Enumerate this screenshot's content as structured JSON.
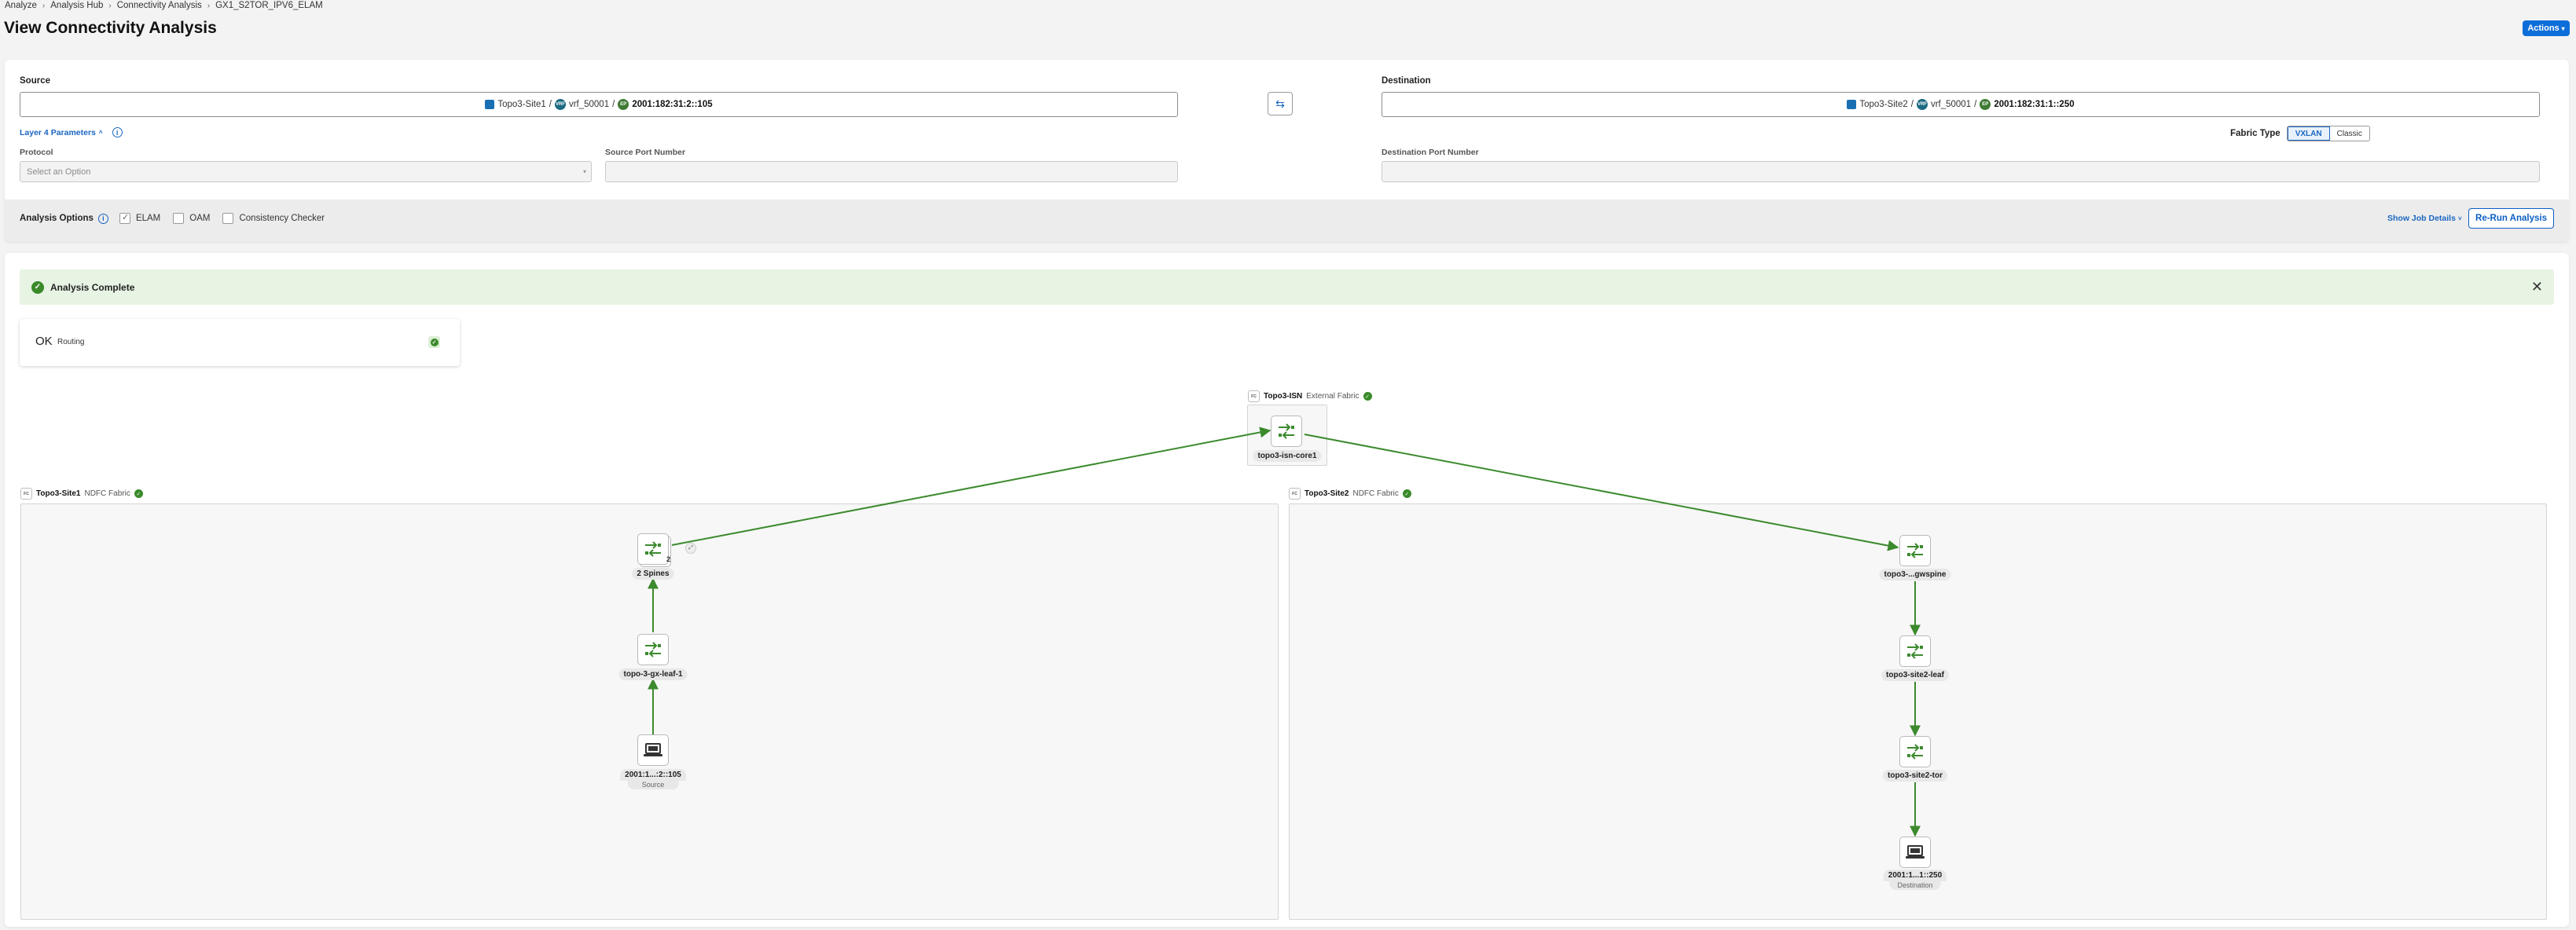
{
  "breadcrumb": [
    "Analyze",
    "Analysis Hub",
    "Connectivity Analysis",
    "GX1_S2TOR_IPV6_ELAM"
  ],
  "page_title": "View Connectivity Analysis",
  "actions_label": "Actions",
  "source": {
    "label": "Source",
    "fabric": "Topo3-Site1",
    "vrf_chip": "VRF",
    "vrf": "vrf_50001",
    "ep_chip": "EP",
    "endpoint": "2001:182:31:2::105"
  },
  "destination": {
    "label": "Destination",
    "fabric": "Topo3-Site2",
    "vrf_chip": "VRF",
    "vrf": "vrf_50001",
    "ep_chip": "EP",
    "endpoint": "2001:182:31:1::250"
  },
  "layer4": {
    "toggle_label": "Layer 4 Parameters",
    "protocol_label": "Protocol",
    "protocol_placeholder": "Select an Option",
    "source_port_label": "Source Port Number",
    "destination_port_label": "Destination Port Number"
  },
  "fabric_type": {
    "label": "Fabric Type",
    "options": [
      "VXLAN",
      "Classic"
    ],
    "selected": "VXLAN"
  },
  "analysis_options": {
    "label": "Analysis Options",
    "items": [
      {
        "label": "ELAM",
        "checked": true
      },
      {
        "label": "OAM",
        "checked": false
      },
      {
        "label": "Consistency Checker",
        "checked": false
      }
    ],
    "show_job_details": "Show Job Details",
    "rerun_label": "Re-Run Analysis"
  },
  "status_banner": "Analysis Complete",
  "summary": {
    "status": "OK",
    "category": "Routing"
  },
  "topology": {
    "isn": {
      "name": "Topo3-ISN",
      "type": "External Fabric",
      "node": "topo3-isn-core1"
    },
    "site1": {
      "name": "Topo3-Site1",
      "type": "NDFC Fabric",
      "spines_label": "2 Spines",
      "spines_count": "2",
      "leaf": "topo-3-gx-leaf-1",
      "endpoint": "2001:1...:2::105",
      "endpoint_role": "Source"
    },
    "site2": {
      "name": "Topo3-Site2",
      "type": "NDFC Fabric",
      "spine": "topo3-...gwspine",
      "leaf": "topo3-site2-leaf",
      "tor": "topo3-site2-tor",
      "endpoint": "2001:1...1::250",
      "endpoint_role": "Destination"
    },
    "fabric_icon_text": "FC"
  },
  "colors": {
    "primary": "#0d6ed9",
    "link_green": "#3c8a2e",
    "success_bg": "#e7f3e3"
  }
}
